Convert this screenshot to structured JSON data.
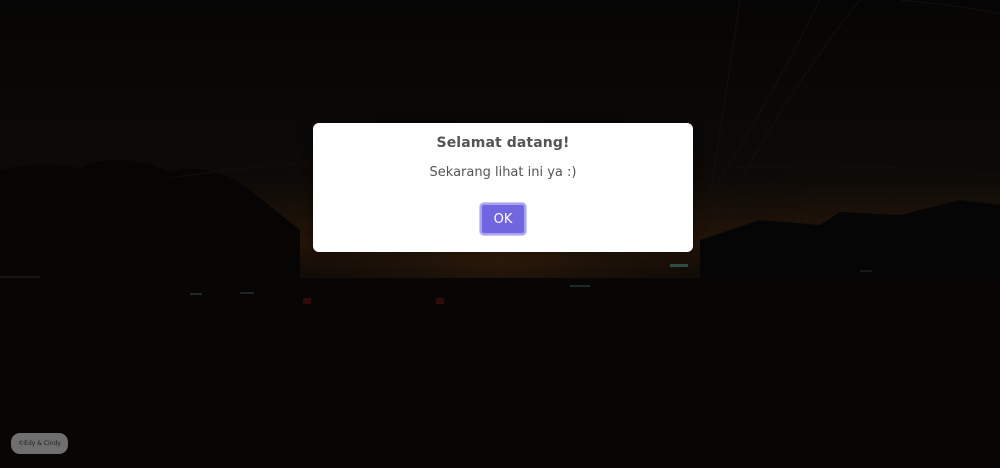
{
  "dialog": {
    "title": "Selamat datang!",
    "message": "Sekarang lihat ini ya :)",
    "ok_label": "OK"
  },
  "footer": {
    "credit": "©Edy & Cindy"
  },
  "colors": {
    "button": "#7066e0",
    "text": "#545454",
    "background": "#0b0a0a"
  }
}
